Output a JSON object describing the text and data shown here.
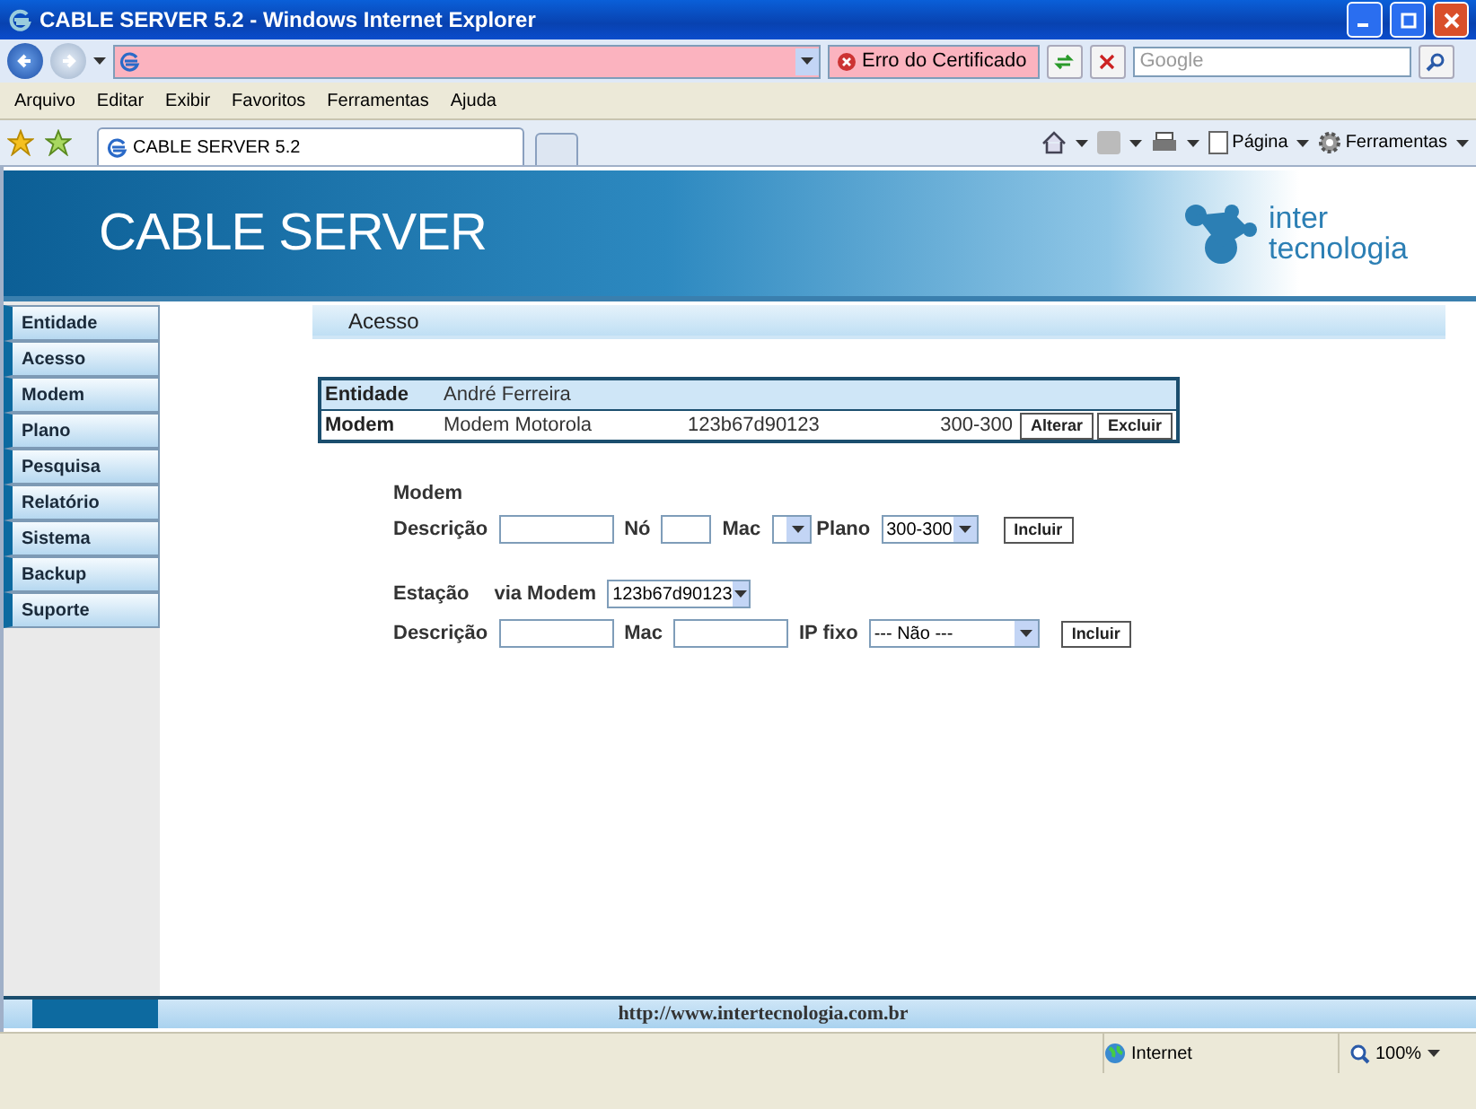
{
  "window": {
    "title": "CABLE SERVER 5.2 - Windows Internet Explorer"
  },
  "address_bar": {
    "certificate_error": "Erro do Certificado",
    "search_placeholder": "Google"
  },
  "menu": [
    "Arquivo",
    "Editar",
    "Exibir",
    "Favoritos",
    "Ferramentas",
    "Ajuda"
  ],
  "tabs": [
    {
      "label": "CABLE SERVER 5.2",
      "selected": true
    }
  ],
  "command_bar": {
    "page": "Página",
    "tools": "Ferramentas"
  },
  "header": {
    "title": "CABLE SERVER",
    "logo_top": "inter",
    "logo_bottom": "tecnologia"
  },
  "sidebar": {
    "items": [
      {
        "label": "Entidade"
      },
      {
        "label": "Acesso"
      },
      {
        "label": "Modem"
      },
      {
        "label": "Plano"
      },
      {
        "label": "Pesquisa"
      },
      {
        "label": "Relatório"
      },
      {
        "label": "Sistema"
      },
      {
        "label": "Backup"
      },
      {
        "label": "Suporte"
      }
    ]
  },
  "section_title": "Acesso",
  "summary": {
    "entity_label": "Entidade",
    "entity_name": "André Ferreira",
    "modem_label": "Modem",
    "modem_name": "Modem Motorola",
    "mac": "123b67d90123",
    "plan": "300-300",
    "buttons": [
      "Alterar",
      "Excluir"
    ]
  },
  "modem_form": {
    "heading": "Modem",
    "description_label": "Descrição",
    "node_label": "Nó",
    "mac_label": "Mac",
    "plan_label": "Plano",
    "plan_value": "300-300",
    "button": "Incluir"
  },
  "station_form": {
    "heading": "Estação",
    "via_label": "via Modem",
    "via_value": "123b67d90123",
    "description_label": "Descrição",
    "mac_label": "Mac",
    "ip_label": "IP fixo",
    "ip_value": "--- Não ---",
    "button": "Incluir"
  },
  "footer": {
    "url": "http://www.intertecnologia.com.br"
  },
  "status_bar": {
    "zone": "Internet",
    "zoom": "100%"
  }
}
